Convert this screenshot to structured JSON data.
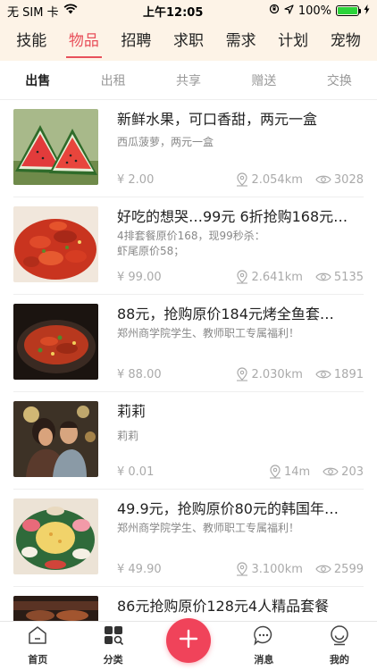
{
  "status": {
    "carrier": "无 SIM 卡",
    "time": "上午12:05",
    "battery": "100%"
  },
  "categories": [
    {
      "label": "技能",
      "active": false
    },
    {
      "label": "物品",
      "active": true
    },
    {
      "label": "招聘",
      "active": false
    },
    {
      "label": "求职",
      "active": false
    },
    {
      "label": "需求",
      "active": false
    },
    {
      "label": "计划",
      "active": false
    },
    {
      "label": "宠物",
      "active": false
    }
  ],
  "sub_tabs": [
    {
      "label": "出售",
      "active": true
    },
    {
      "label": "出租",
      "active": false
    },
    {
      "label": "共享",
      "active": false
    },
    {
      "label": "赠送",
      "active": false
    },
    {
      "label": "交换",
      "active": false
    }
  ],
  "items": [
    {
      "title": "新鲜水果，可口香甜，两元一盒",
      "desc": "西瓜菠萝，两元一盒",
      "price": "¥ 2.00",
      "distance": "2.054km",
      "views": "3028",
      "thumb": "watermelon"
    },
    {
      "title": "好吃的想哭…99元 6折抢购168元…",
      "desc": "4排套餐原价168，现99秒杀：\n虾尾原价58；",
      "price": "¥ 99.00",
      "distance": "2.641km",
      "views": "5135",
      "thumb": "crayfish"
    },
    {
      "title": "88元，抢购原价184元烤全鱼套…",
      "desc": "郑州商学院学生、教师职工专属福利！",
      "price": "¥ 88.00",
      "distance": "2.030km",
      "views": "1891",
      "thumb": "fish"
    },
    {
      "title": "莉莉",
      "desc": "莉莉",
      "price": "¥ 0.01",
      "distance": "14m",
      "views": "203",
      "thumb": "couple"
    },
    {
      "title": "49.9元，抢购原价80元的韩国年…",
      "desc": "郑州商学院学生、教师职工专属福利！",
      "price": "¥ 49.90",
      "distance": "3.100km",
      "views": "2599",
      "thumb": "ricecake"
    },
    {
      "title": "86元抢购原价128元4人精品套餐",
      "desc": "",
      "price": "",
      "distance": "",
      "views": "",
      "thumb": "bbq"
    }
  ],
  "tabbar": {
    "home": "首页",
    "category": "分类",
    "messages": "消息",
    "mine": "我的"
  },
  "colors": {
    "accent": "#e8505b",
    "fab": "#f0435a",
    "header_bg": "#fdf3e7",
    "battery": "#2bd33a"
  }
}
